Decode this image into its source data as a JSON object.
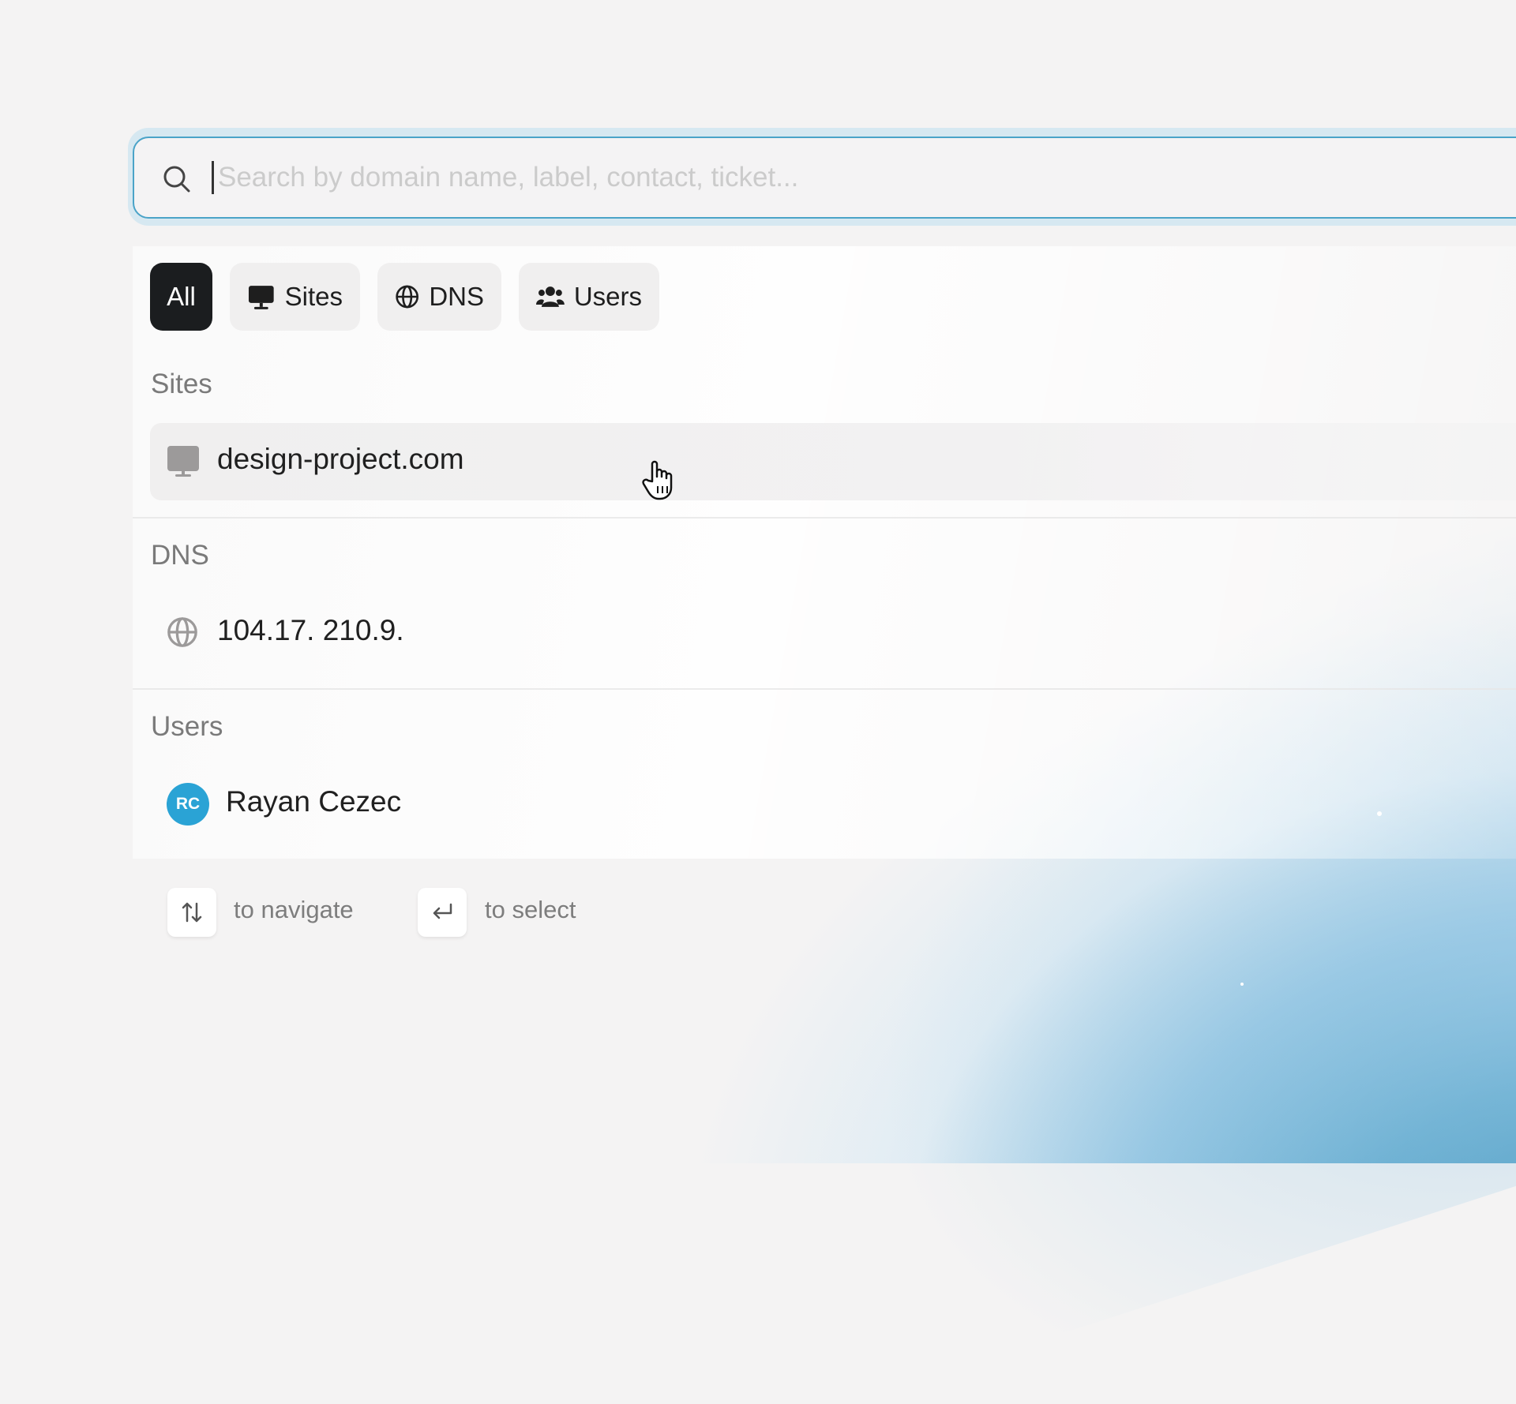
{
  "search": {
    "placeholder": "Search by domain name, label, contact, ticket...",
    "value": ""
  },
  "filters": [
    {
      "label": "All",
      "icon": "none",
      "active": true
    },
    {
      "label": "Sites",
      "icon": "monitor-icon",
      "active": false
    },
    {
      "label": "DNS",
      "icon": "globe-icon",
      "active": false
    },
    {
      "label": "Users",
      "icon": "users-icon",
      "active": false
    }
  ],
  "sections": {
    "sites": {
      "label": "Sites",
      "items": [
        {
          "text": "design-project.com",
          "icon": "monitor-icon"
        }
      ]
    },
    "dns": {
      "label": "DNS",
      "items": [
        {
          "text": "104.17. 210.9.",
          "icon": "globe-icon"
        }
      ]
    },
    "users": {
      "label": "Users",
      "items": [
        {
          "name": "Rayan Cezec",
          "initials": "RC",
          "avatar_color": "#2aa3d5"
        }
      ]
    }
  },
  "footer": {
    "navigate_hint": "to navigate",
    "select_hint": "to select"
  },
  "colors": {
    "accent": "#4aa3c8",
    "active_chip": "#1b1d1f"
  }
}
